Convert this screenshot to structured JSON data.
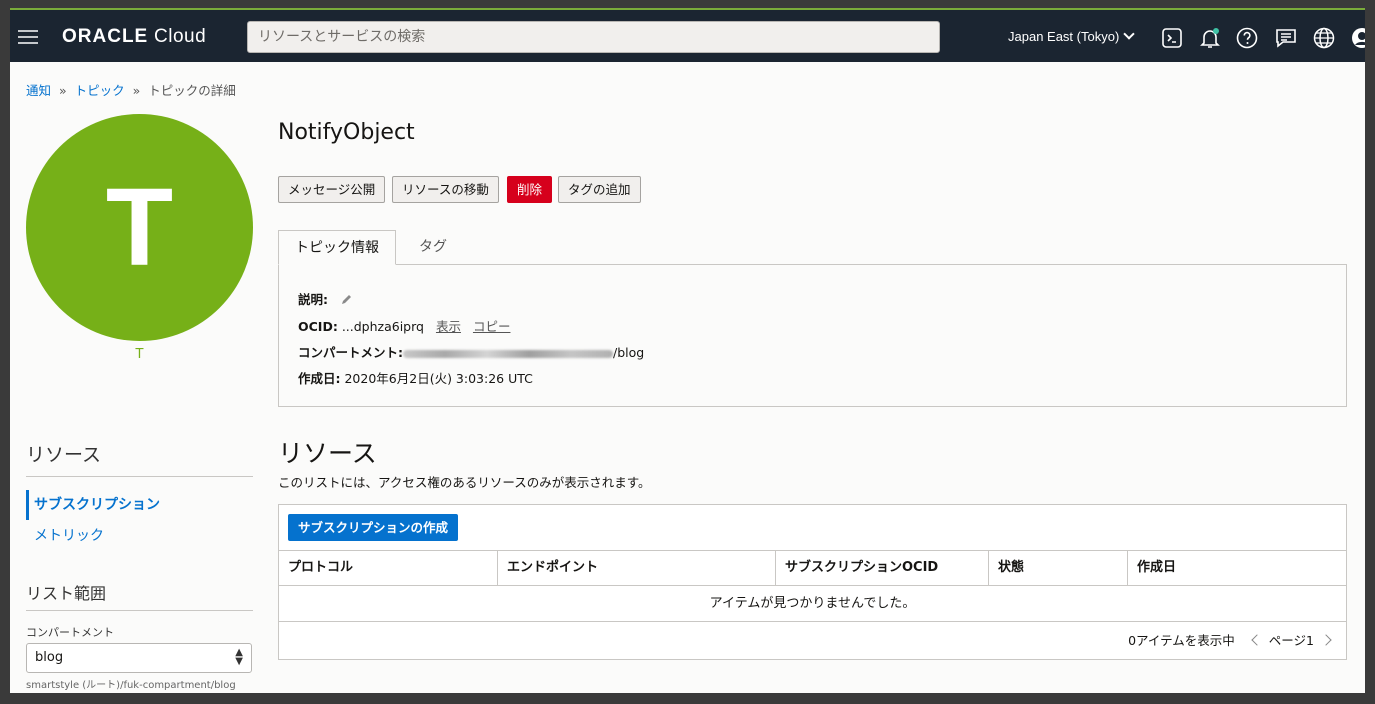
{
  "header": {
    "brand_bold": "ORACLE",
    "brand_light": "Cloud",
    "search_placeholder": "リソースとサービスの検索",
    "region": "Japan East (Tokyo)"
  },
  "breadcrumb": {
    "items": [
      "通知",
      "トピック"
    ],
    "current": "トピックの詳細",
    "separator": "»"
  },
  "avatar": {
    "letter": "T",
    "caption": "T",
    "color": "#76b018"
  },
  "page": {
    "title": "NotifyObject",
    "actions": [
      "メッセージ公開",
      "リソースの移動",
      "削除",
      "タグの追加"
    ]
  },
  "tabs": [
    "トピック情報",
    "タグ"
  ],
  "info": {
    "description_label": "説明:",
    "ocid_label": "OCID:",
    "ocid_value": "...dphza6iprq",
    "show_link": "表示",
    "copy_link": "コピー",
    "compartment_label": "コンパートメント:",
    "compartment_suffix": "/blog",
    "created_label": "作成日:",
    "created_value": "2020年6月2日(火) 3:03:26 UTC"
  },
  "resources": {
    "title": "リソース",
    "subtitle": "このリストには、アクセス権のあるリソースのみが表示されます。",
    "create_button": "サブスクリプションの作成",
    "columns": [
      "プロトコル",
      "エンドポイント",
      "サブスクリプションOCID",
      "状態",
      "作成日"
    ],
    "empty_text": "アイテムが見つかりませんでした。",
    "pager_count": "0アイテムを表示中",
    "pager_page": "ページ1"
  },
  "sidebar": {
    "resources_title": "リソース",
    "items": [
      "サブスクリプション",
      "メトリック"
    ],
    "scope_title": "リスト範囲",
    "compartment_label": "コンパートメント",
    "compartment_value": "blog",
    "compartment_path": "smartstyle (ルート)/fuk-compartment/blog"
  },
  "colors": {
    "header_bg": "#1b2531",
    "accent_blue": "#0572ce",
    "danger_red": "#d6001c",
    "avatar_green": "#76b018"
  }
}
